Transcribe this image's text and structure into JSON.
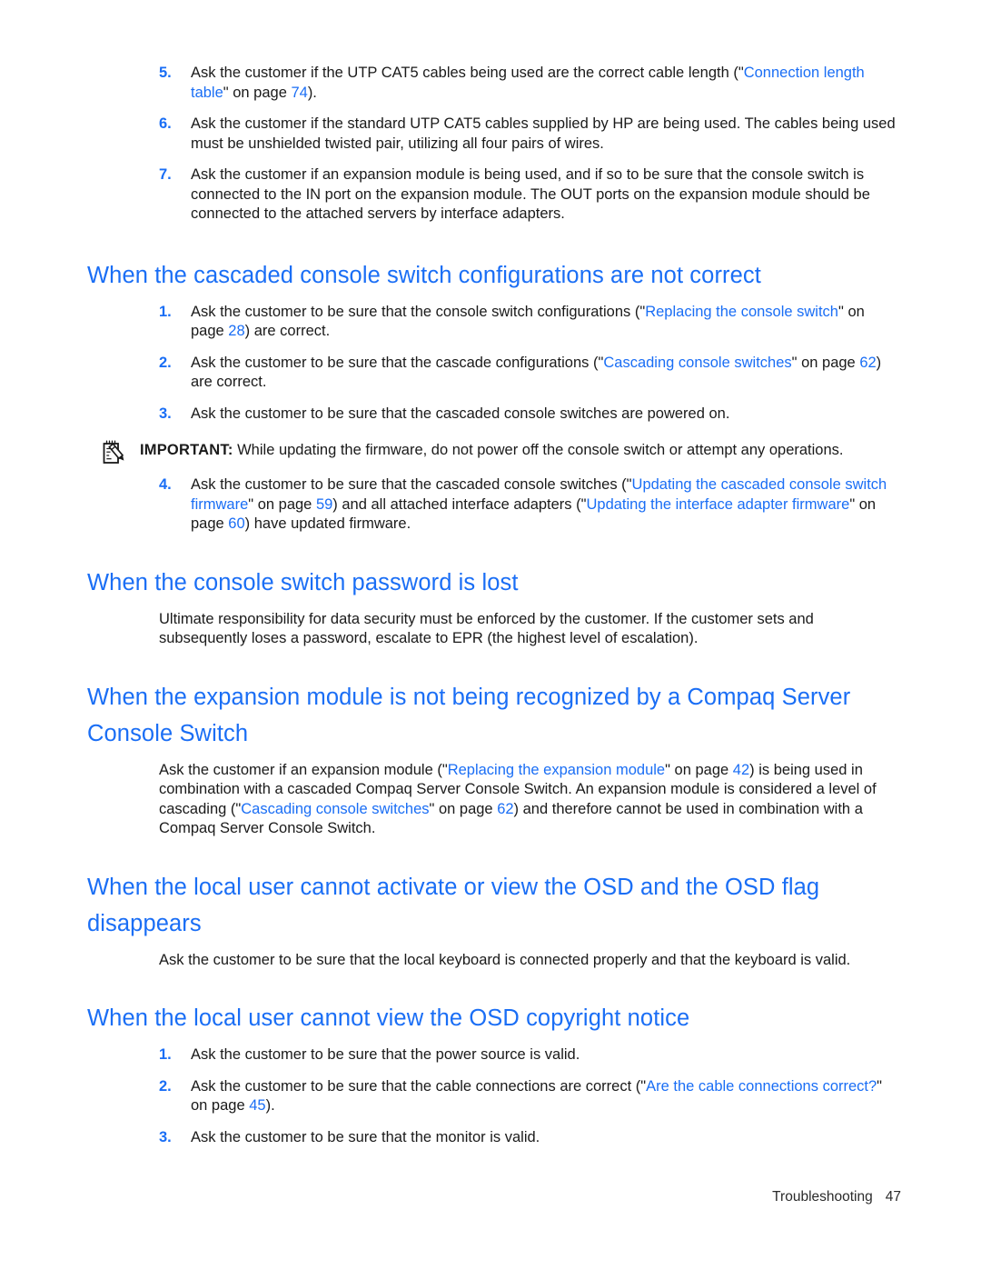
{
  "document": {
    "footer": {
      "chapter": "Troubleshooting",
      "page_number": "47"
    },
    "colors": {
      "heading_blue": "#1a6ef5",
      "link_blue": "#1a6ef5",
      "body_text": "#1a1a1a",
      "page_background": "#ffffff"
    }
  },
  "top_list": {
    "items": [
      {
        "number": "5.",
        "pre": "Ask the customer if the UTP CAT5 cables being used are the correct cable length (\"",
        "link": "Connection length table",
        "mid": "\" on page ",
        "page": "74",
        "post": ")."
      },
      {
        "number": "6.",
        "text": "Ask the customer if the standard UTP CAT5 cables supplied by HP are being used. The cables being used must be unshielded twisted pair, utilizing all four pairs of wires."
      },
      {
        "number": "7.",
        "text": "Ask the customer if an expansion module is being used, and if so to be sure that the console switch is connected to the IN port on the expansion module. The OUT ports on the expansion module should be connected to the attached servers by interface adapters."
      }
    ]
  },
  "section_cascaded": {
    "heading": "When the cascaded console switch configurations are not correct",
    "items": [
      {
        "number": "1.",
        "pre": "Ask the customer to be sure that the console switch configurations (\"",
        "link": "Replacing the console switch",
        "mid": "\" on page ",
        "page": "28",
        "post": ") are correct."
      },
      {
        "number": "2.",
        "pre": "Ask the customer to be sure that the cascade configurations (\"",
        "link": "Cascading console switches",
        "mid": "\" on page ",
        "page": "62",
        "post": ") are correct."
      },
      {
        "number": "3.",
        "text": "Ask the customer to be sure that the cascaded console switches are powered on."
      }
    ],
    "callout": {
      "icon": "notepad-pencil-icon",
      "title": "IMPORTANT:",
      "text": "While updating the firmware, do not power off the console switch or attempt any operations."
    },
    "items_after_callout": [
      {
        "number": "4.",
        "pre": "Ask the customer to be sure that the cascaded console switches (\"",
        "link1": "Updating the cascaded console switch firmware",
        "mid1": "\" on page ",
        "page1": "59",
        "mid2": ") and all attached interface adapters (\"",
        "link2": "Updating the interface adapter firmware",
        "mid3": "\" on page ",
        "page2": "60",
        "post": ") have updated firmware."
      }
    ]
  },
  "section_password": {
    "heading": "When the console switch password is lost",
    "paragraph": "Ultimate responsibility for data security must be enforced by the customer. If the customer sets and subsequently loses a password, escalate to EPR (the highest level of escalation)."
  },
  "section_expansion": {
    "heading": "When the expansion module is not being recognized by a Compaq Server Console Switch",
    "paragraph": {
      "pre": "Ask the customer if an expansion module (\"",
      "link1": "Replacing the expansion module",
      "mid1": "\" on page ",
      "page1": "42",
      "mid2": ") is being used in combination with a cascaded Compaq Server Console Switch. An expansion module is considered a level of cascading (\"",
      "link2": "Cascading console switches",
      "mid3": "\" on page ",
      "page2": "62",
      "post": ") and therefore cannot be used in combination with a Compaq Server Console Switch."
    }
  },
  "section_osd_flag": {
    "heading": "When the local user cannot activate or view the OSD and the OSD flag disappears",
    "paragraph": "Ask the customer to be sure that the local keyboard is connected properly and that the keyboard is valid."
  },
  "section_osd_copyright": {
    "heading": "When the local user cannot view the OSD copyright notice",
    "items": [
      {
        "number": "1.",
        "text": "Ask the customer to be sure that the power source is valid."
      },
      {
        "number": "2.",
        "pre": "Ask the customer to be sure that the cable connections are correct (\"",
        "link": "Are the cable connections correct?",
        "mid": "\" on page ",
        "page": "45",
        "post": ")."
      },
      {
        "number": "3.",
        "text": "Ask the customer to be sure that the monitor is valid."
      }
    ]
  }
}
